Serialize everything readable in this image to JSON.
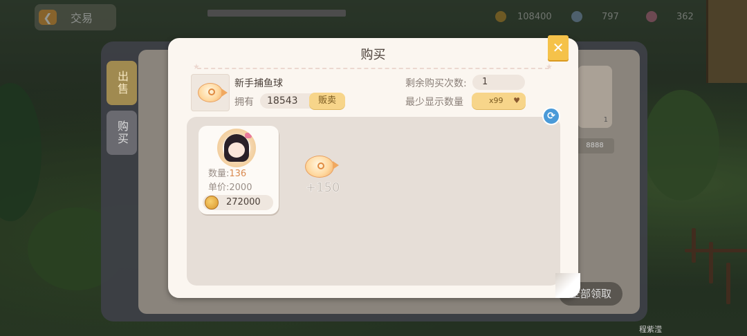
{
  "topbar": {
    "back_label": "交易",
    "currencies": [
      {
        "icon": "gold-coin-icon",
        "value": "108400"
      },
      {
        "icon": "diamond-icon",
        "value": "797"
      },
      {
        "icon": "gem-icon",
        "value": "362"
      }
    ]
  },
  "trade_window": {
    "tabs": [
      {
        "label": "出售",
        "active": true
      },
      {
        "label": "购买",
        "active": false
      }
    ],
    "bg_item_count": "1",
    "bg_item_price": "8888",
    "claim_all_label": "全部领取",
    "player_name": "程紫滢"
  },
  "dialog": {
    "title": "购买",
    "item": {
      "name": "新手捕鱼球",
      "own_label": "拥有",
      "own_value": "18543",
      "sell_label": "贩卖"
    },
    "remaining": {
      "label": "剩余购买次数:",
      "value": "1"
    },
    "min_display": {
      "label": "最少显示数量",
      "value": "x99"
    },
    "listing": {
      "qty_label": "数量:",
      "qty_value": "136",
      "price_label": "单价:",
      "price_value": "2000",
      "total": "272000"
    },
    "reward_amount": "+150"
  },
  "colors": {
    "dialog_bg": "#fbf6f0",
    "accent_yellow": "#f5c24a",
    "refresh_blue": "#4a9ad8"
  }
}
